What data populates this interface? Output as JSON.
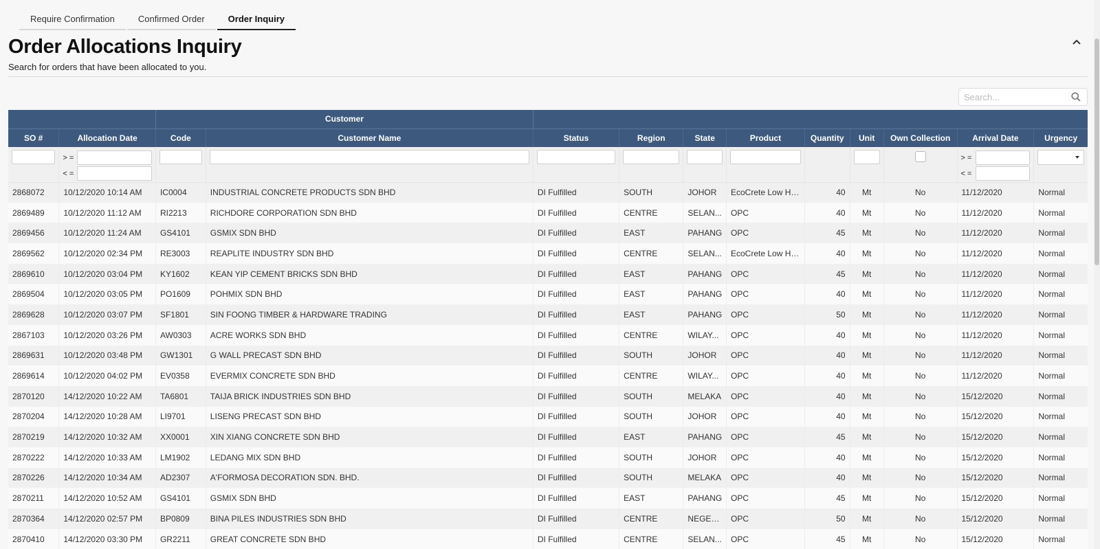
{
  "tabs": [
    {
      "label": "Require Confirmation",
      "active": false
    },
    {
      "label": "Confirmed Order",
      "active": false
    },
    {
      "label": "Order Inquiry",
      "active": true
    }
  ],
  "page": {
    "title": "Order Allocations Inquiry",
    "subtitle": "Search for orders that have been allocated to you.",
    "collapse_icon": "chevron-up-icon"
  },
  "search": {
    "placeholder": "Search...",
    "value": "",
    "icon": "search-icon"
  },
  "table": {
    "group_header": "Customer",
    "columns": [
      "SO #",
      "Allocation Date",
      "Code",
      "Customer Name",
      "Status",
      "Region",
      "State",
      "Product",
      "Quantity",
      "Unit",
      "Own Collection",
      "Arrival Date",
      "Urgency"
    ],
    "filters": {
      "ge": "> =",
      "le": "< =",
      "urgency_value": ""
    },
    "header_color": "#3d5a7e",
    "rows": [
      [
        "2868072",
        "10/12/2020 10:14 AM",
        "IC0004",
        "INDUSTRIAL CONCRETE PRODUCTS SDN BHD",
        "DI Fulfilled",
        "SOUTH",
        "JOHOR",
        "EcoCrete Low Heat",
        "40",
        "Mt",
        "No",
        "11/12/2020",
        "Normal"
      ],
      [
        "2869489",
        "10/12/2020 11:12 AM",
        "RI2213",
        "RICHDORE CORPORATION SDN BHD",
        "DI Fulfilled",
        "CENTRE",
        "SELAN...",
        "OPC",
        "40",
        "Mt",
        "No",
        "11/12/2020",
        "Normal"
      ],
      [
        "2869456",
        "10/12/2020 11:24 AM",
        "GS4101",
        "GSMIX SDN BHD",
        "DI Fulfilled",
        "EAST",
        "PAHANG",
        "OPC",
        "45",
        "Mt",
        "No",
        "11/12/2020",
        "Normal"
      ],
      [
        "2869562",
        "10/12/2020 02:34 PM",
        "RE3003",
        "REAPLITE INDUSTRY SDN BHD",
        "DI Fulfilled",
        "CENTRE",
        "SELAN...",
        "EcoCrete Low Heat",
        "40",
        "Mt",
        "No",
        "11/12/2020",
        "Normal"
      ],
      [
        "2869610",
        "10/12/2020 03:04 PM",
        "KY1602",
        "KEAN YIP CEMENT BRICKS SDN BHD",
        "DI Fulfilled",
        "EAST",
        "PAHANG",
        "OPC",
        "45",
        "Mt",
        "No",
        "11/12/2020",
        "Normal"
      ],
      [
        "2869504",
        "10/12/2020 03:05 PM",
        "PO1609",
        "POHMIX SDN BHD",
        "DI Fulfilled",
        "EAST",
        "PAHANG",
        "OPC",
        "40",
        "Mt",
        "No",
        "11/12/2020",
        "Normal"
      ],
      [
        "2869628",
        "10/12/2020 03:07 PM",
        "SF1801",
        "SIN FOONG TIMBER & HARDWARE TRADING",
        "DI Fulfilled",
        "EAST",
        "PAHANG",
        "OPC",
        "50",
        "Mt",
        "No",
        "11/12/2020",
        "Normal"
      ],
      [
        "2867103",
        "10/12/2020 03:26 PM",
        "AW0303",
        "ACRE WORKS SDN BHD",
        "DI Fulfilled",
        "CENTRE",
        "WILAY...",
        "OPC",
        "40",
        "Mt",
        "No",
        "11/12/2020",
        "Normal"
      ],
      [
        "2869631",
        "10/12/2020 03:48 PM",
        "GW1301",
        "G WALL PRECAST SDN BHD",
        "DI Fulfilled",
        "SOUTH",
        "JOHOR",
        "OPC",
        "40",
        "Mt",
        "No",
        "11/12/2020",
        "Normal"
      ],
      [
        "2869614",
        "10/12/2020 04:02 PM",
        "EV0358",
        "EVERMIX CONCRETE SDN BHD",
        "DI Fulfilled",
        "CENTRE",
        "WILAY...",
        "OPC",
        "40",
        "Mt",
        "No",
        "11/12/2020",
        "Normal"
      ],
      [
        "2870120",
        "14/12/2020 10:22 AM",
        "TA6801",
        "TAIJA BRICK INDUSTRIES SDN BHD",
        "DI Fulfilled",
        "SOUTH",
        "MELAKA",
        "OPC",
        "40",
        "Mt",
        "No",
        "15/12/2020",
        "Normal"
      ],
      [
        "2870204",
        "14/12/2020 10:28 AM",
        "LI9701",
        "LISENG PRECAST SDN BHD",
        "DI Fulfilled",
        "SOUTH",
        "JOHOR",
        "OPC",
        "40",
        "Mt",
        "No",
        "15/12/2020",
        "Normal"
      ],
      [
        "2870219",
        "14/12/2020 10:32 AM",
        "XX0001",
        "XIN XIANG CONCRETE SDN BHD",
        "DI Fulfilled",
        "EAST",
        "PAHANG",
        "OPC",
        "45",
        "Mt",
        "No",
        "15/12/2020",
        "Normal"
      ],
      [
        "2870222",
        "14/12/2020 10:33 AM",
        "LM1902",
        "LEDANG MIX SDN BHD",
        "DI Fulfilled",
        "SOUTH",
        "JOHOR",
        "OPC",
        "40",
        "Mt",
        "No",
        "15/12/2020",
        "Normal"
      ],
      [
        "2870226",
        "14/12/2020 10:34 AM",
        "AD2307",
        "A'FORMOSA DECORATION SDN. BHD.",
        "DI Fulfilled",
        "SOUTH",
        "MELAKA",
        "OPC",
        "40",
        "Mt",
        "No",
        "15/12/2020",
        "Normal"
      ],
      [
        "2870211",
        "14/12/2020 10:52 AM",
        "GS4101",
        "GSMIX SDN BHD",
        "DI Fulfilled",
        "EAST",
        "PAHANG",
        "OPC",
        "45",
        "Mt",
        "No",
        "15/12/2020",
        "Normal"
      ],
      [
        "2870364",
        "14/12/2020 02:57 PM",
        "BP0809",
        "BINA PILES INDUSTRIES SDN BHD",
        "DI Fulfilled",
        "CENTRE",
        "NEGERI...",
        "OPC",
        "50",
        "Mt",
        "No",
        "15/12/2020",
        "Normal"
      ],
      [
        "2870410",
        "14/12/2020 03:30 PM",
        "GR2211",
        "GREAT CONCRETE SDN BHD",
        "DI Fulfilled",
        "CENTRE",
        "SELAN...",
        "OPC",
        "45",
        "Mt",
        "No",
        "15/12/2020",
        "Normal"
      ]
    ]
  }
}
